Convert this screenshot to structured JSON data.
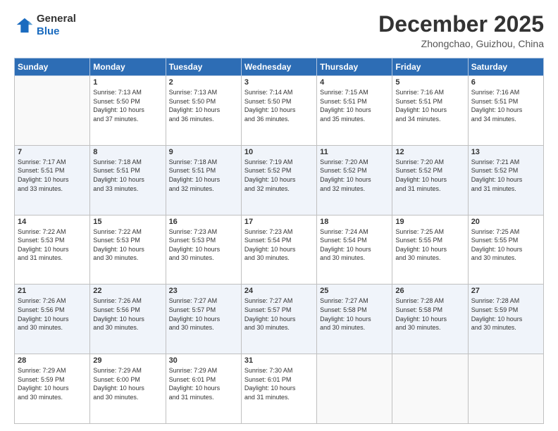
{
  "header": {
    "logo_line1": "General",
    "logo_line2": "Blue",
    "month": "December 2025",
    "location": "Zhongchao, Guizhou, China"
  },
  "days_of_week": [
    "Sunday",
    "Monday",
    "Tuesday",
    "Wednesday",
    "Thursday",
    "Friday",
    "Saturday"
  ],
  "weeks": [
    [
      {
        "day": "",
        "info": ""
      },
      {
        "day": "1",
        "info": "Sunrise: 7:13 AM\nSunset: 5:50 PM\nDaylight: 10 hours\nand 37 minutes."
      },
      {
        "day": "2",
        "info": "Sunrise: 7:13 AM\nSunset: 5:50 PM\nDaylight: 10 hours\nand 36 minutes."
      },
      {
        "day": "3",
        "info": "Sunrise: 7:14 AM\nSunset: 5:50 PM\nDaylight: 10 hours\nand 36 minutes."
      },
      {
        "day": "4",
        "info": "Sunrise: 7:15 AM\nSunset: 5:51 PM\nDaylight: 10 hours\nand 35 minutes."
      },
      {
        "day": "5",
        "info": "Sunrise: 7:16 AM\nSunset: 5:51 PM\nDaylight: 10 hours\nand 34 minutes."
      },
      {
        "day": "6",
        "info": "Sunrise: 7:16 AM\nSunset: 5:51 PM\nDaylight: 10 hours\nand 34 minutes."
      }
    ],
    [
      {
        "day": "7",
        "info": "Sunrise: 7:17 AM\nSunset: 5:51 PM\nDaylight: 10 hours\nand 33 minutes."
      },
      {
        "day": "8",
        "info": "Sunrise: 7:18 AM\nSunset: 5:51 PM\nDaylight: 10 hours\nand 33 minutes."
      },
      {
        "day": "9",
        "info": "Sunrise: 7:18 AM\nSunset: 5:51 PM\nDaylight: 10 hours\nand 32 minutes."
      },
      {
        "day": "10",
        "info": "Sunrise: 7:19 AM\nSunset: 5:52 PM\nDaylight: 10 hours\nand 32 minutes."
      },
      {
        "day": "11",
        "info": "Sunrise: 7:20 AM\nSunset: 5:52 PM\nDaylight: 10 hours\nand 32 minutes."
      },
      {
        "day": "12",
        "info": "Sunrise: 7:20 AM\nSunset: 5:52 PM\nDaylight: 10 hours\nand 31 minutes."
      },
      {
        "day": "13",
        "info": "Sunrise: 7:21 AM\nSunset: 5:52 PM\nDaylight: 10 hours\nand 31 minutes."
      }
    ],
    [
      {
        "day": "14",
        "info": "Sunrise: 7:22 AM\nSunset: 5:53 PM\nDaylight: 10 hours\nand 31 minutes."
      },
      {
        "day": "15",
        "info": "Sunrise: 7:22 AM\nSunset: 5:53 PM\nDaylight: 10 hours\nand 30 minutes."
      },
      {
        "day": "16",
        "info": "Sunrise: 7:23 AM\nSunset: 5:53 PM\nDaylight: 10 hours\nand 30 minutes."
      },
      {
        "day": "17",
        "info": "Sunrise: 7:23 AM\nSunset: 5:54 PM\nDaylight: 10 hours\nand 30 minutes."
      },
      {
        "day": "18",
        "info": "Sunrise: 7:24 AM\nSunset: 5:54 PM\nDaylight: 10 hours\nand 30 minutes."
      },
      {
        "day": "19",
        "info": "Sunrise: 7:25 AM\nSunset: 5:55 PM\nDaylight: 10 hours\nand 30 minutes."
      },
      {
        "day": "20",
        "info": "Sunrise: 7:25 AM\nSunset: 5:55 PM\nDaylight: 10 hours\nand 30 minutes."
      }
    ],
    [
      {
        "day": "21",
        "info": "Sunrise: 7:26 AM\nSunset: 5:56 PM\nDaylight: 10 hours\nand 30 minutes."
      },
      {
        "day": "22",
        "info": "Sunrise: 7:26 AM\nSunset: 5:56 PM\nDaylight: 10 hours\nand 30 minutes."
      },
      {
        "day": "23",
        "info": "Sunrise: 7:27 AM\nSunset: 5:57 PM\nDaylight: 10 hours\nand 30 minutes."
      },
      {
        "day": "24",
        "info": "Sunrise: 7:27 AM\nSunset: 5:57 PM\nDaylight: 10 hours\nand 30 minutes."
      },
      {
        "day": "25",
        "info": "Sunrise: 7:27 AM\nSunset: 5:58 PM\nDaylight: 10 hours\nand 30 minutes."
      },
      {
        "day": "26",
        "info": "Sunrise: 7:28 AM\nSunset: 5:58 PM\nDaylight: 10 hours\nand 30 minutes."
      },
      {
        "day": "27",
        "info": "Sunrise: 7:28 AM\nSunset: 5:59 PM\nDaylight: 10 hours\nand 30 minutes."
      }
    ],
    [
      {
        "day": "28",
        "info": "Sunrise: 7:29 AM\nSunset: 5:59 PM\nDaylight: 10 hours\nand 30 minutes."
      },
      {
        "day": "29",
        "info": "Sunrise: 7:29 AM\nSunset: 6:00 PM\nDaylight: 10 hours\nand 30 minutes."
      },
      {
        "day": "30",
        "info": "Sunrise: 7:29 AM\nSunset: 6:01 PM\nDaylight: 10 hours\nand 31 minutes."
      },
      {
        "day": "31",
        "info": "Sunrise: 7:30 AM\nSunset: 6:01 PM\nDaylight: 10 hours\nand 31 minutes."
      },
      {
        "day": "",
        "info": ""
      },
      {
        "day": "",
        "info": ""
      },
      {
        "day": "",
        "info": ""
      }
    ]
  ]
}
